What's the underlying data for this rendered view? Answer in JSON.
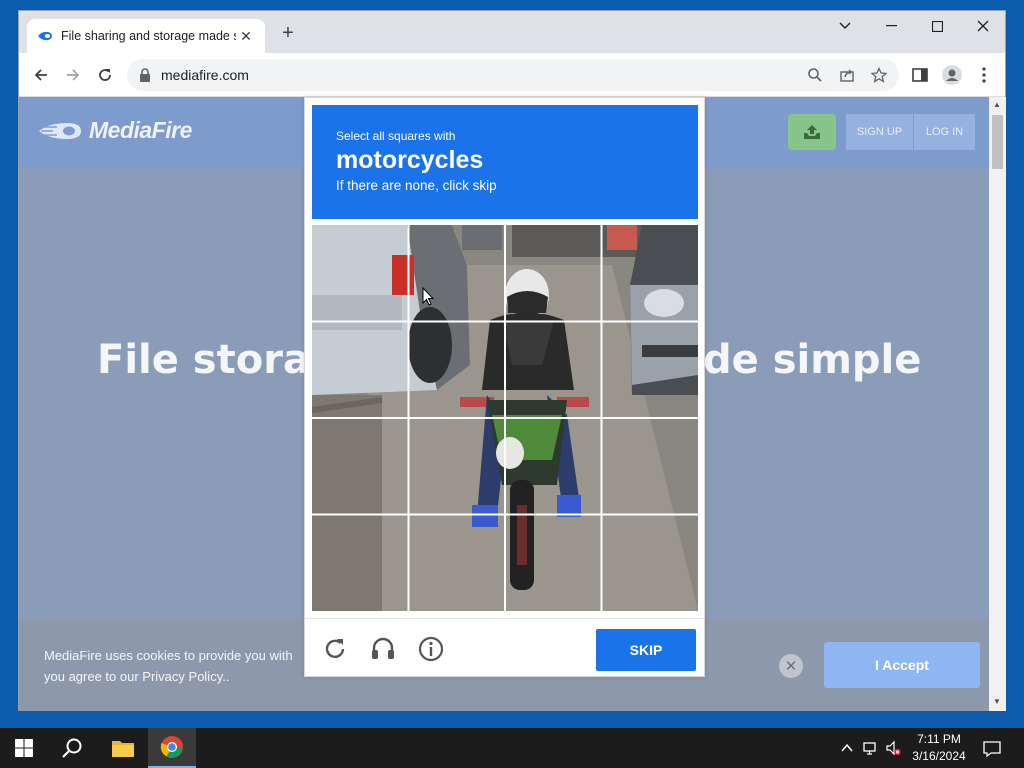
{
  "browser": {
    "tab_title": "File sharing and storage made simple",
    "url": "mediafire.com"
  },
  "site": {
    "logo_text": "MediaFire",
    "sign_up": "SIGN UP",
    "log_in": "LOG IN",
    "hero_left": "File storag",
    "hero_right": "de simple"
  },
  "cookie": {
    "text": "MediaFire uses cookies to provide you with",
    "text_tail": ",",
    "text2": "you agree to our Privacy Policy..",
    "accept": "I Accept"
  },
  "captcha": {
    "instruction": "Select all squares with",
    "target": "motorcycles",
    "hint": "If there are none, click skip",
    "skip": "SKIP",
    "grid_rows": 4,
    "grid_cols": 4
  },
  "taskbar": {
    "time": "7:11 PM",
    "date": "3/16/2024"
  },
  "colors": {
    "captcha_blue": "#1a73e8",
    "mediafire_header": "#7e9bce",
    "taskbar": "#1c1c1c"
  }
}
